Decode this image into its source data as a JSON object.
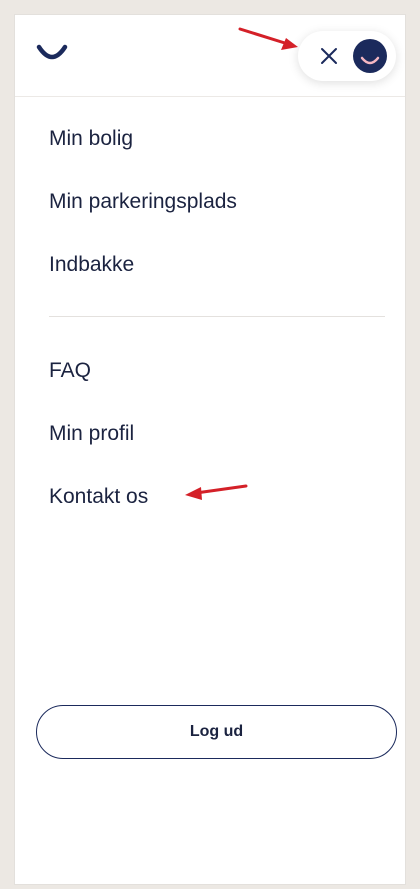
{
  "header": {
    "logo_icon": "smile-logo-icon",
    "close_icon": "close-icon",
    "avatar_icon": "smile-avatar-icon"
  },
  "nav": {
    "primary": [
      {
        "label": "Min bolig"
      },
      {
        "label": "Min parkeringsplads"
      },
      {
        "label": "Indbakke"
      }
    ],
    "secondary": [
      {
        "label": "FAQ"
      },
      {
        "label": "Min profil"
      },
      {
        "label": "Kontakt os"
      }
    ]
  },
  "logout": {
    "label": "Log ud"
  },
  "colors": {
    "brand_navy": "#1b2a5c",
    "accent_pink": "#f4b6c2",
    "annotation_red": "#d42028",
    "text": "#1b2340"
  }
}
